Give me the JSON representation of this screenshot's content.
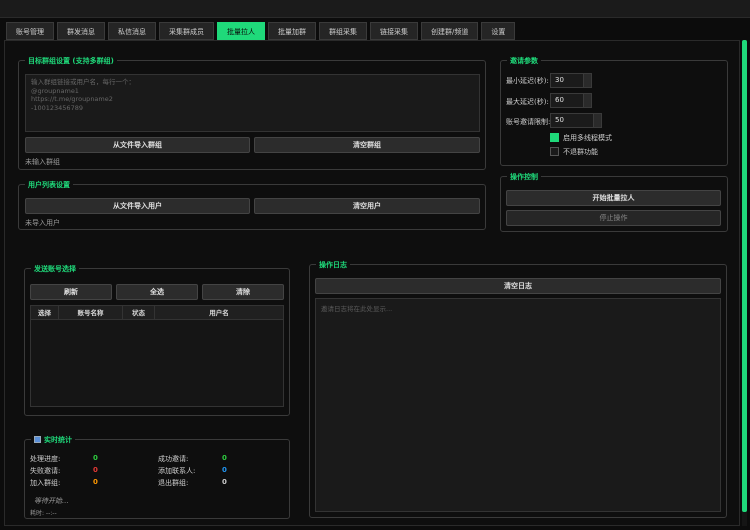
{
  "tabs": [
    "账号管理",
    "群发消息",
    "私信消息",
    "采集群成员",
    "批量拉人",
    "批量加群",
    "群组采集",
    "链接采集",
    "创建群/频道",
    "设置"
  ],
  "active_tab": 4,
  "target_group": {
    "title": "目标群组设置 (支持多群组)",
    "placeholder": "输入群组链接或用户名，每行一个：\n@groupname1\nhttps://t.me/groupname2\n-100123456789",
    "import_button": "从文件导入群组",
    "clear_button": "清空群组",
    "status": "未输入群组"
  },
  "user_list": {
    "title": "用户列表设置",
    "import_button": "从文件导入用户",
    "clear_button": "清空用户",
    "status": "未导入用户"
  },
  "invite_params": {
    "title": "邀请参数",
    "min_delay_label": "最小延迟(秒):",
    "min_delay_value": "30",
    "max_delay_label": "最大延迟(秒):",
    "max_delay_value": "60",
    "limit_label": "账号邀请限制:",
    "limit_value": "50",
    "multithread_label": "启用多线程模式",
    "multithread_on": true,
    "leave_label": "不退群功能",
    "leave_on": false
  },
  "operation": {
    "title": "操作控制",
    "start_button": "开始批量拉人",
    "stop_button": "停止操作"
  },
  "accounts": {
    "title": "发送账号选择",
    "refresh_button": "刷新",
    "select_all_button": "全选",
    "clear_button": "清除",
    "columns": [
      "选择",
      "账号名称",
      "状态",
      "用户名"
    ]
  },
  "log": {
    "title": "操作日志",
    "clear_button": "清空日志",
    "placeholder": "邀请日志将在此处显示..."
  },
  "stats": {
    "title": "实时统计",
    "items": [
      {
        "label": "处理进度:",
        "value": "0",
        "color": "#2ecc40"
      },
      {
        "label": "成功邀请:",
        "value": "0",
        "color": "#2ecc40"
      },
      {
        "label": "失败邀请:",
        "value": "0",
        "color": "#e53935"
      },
      {
        "label": "添加联系人:",
        "value": "0",
        "color": "#2196f3"
      },
      {
        "label": "加入群组:",
        "value": "0",
        "color": "#ff9800"
      },
      {
        "label": "退出群组:",
        "value": "0",
        "color": "#cccccc"
      }
    ],
    "waiting": "等待开始...",
    "elapsed": "耗时: --:--"
  }
}
